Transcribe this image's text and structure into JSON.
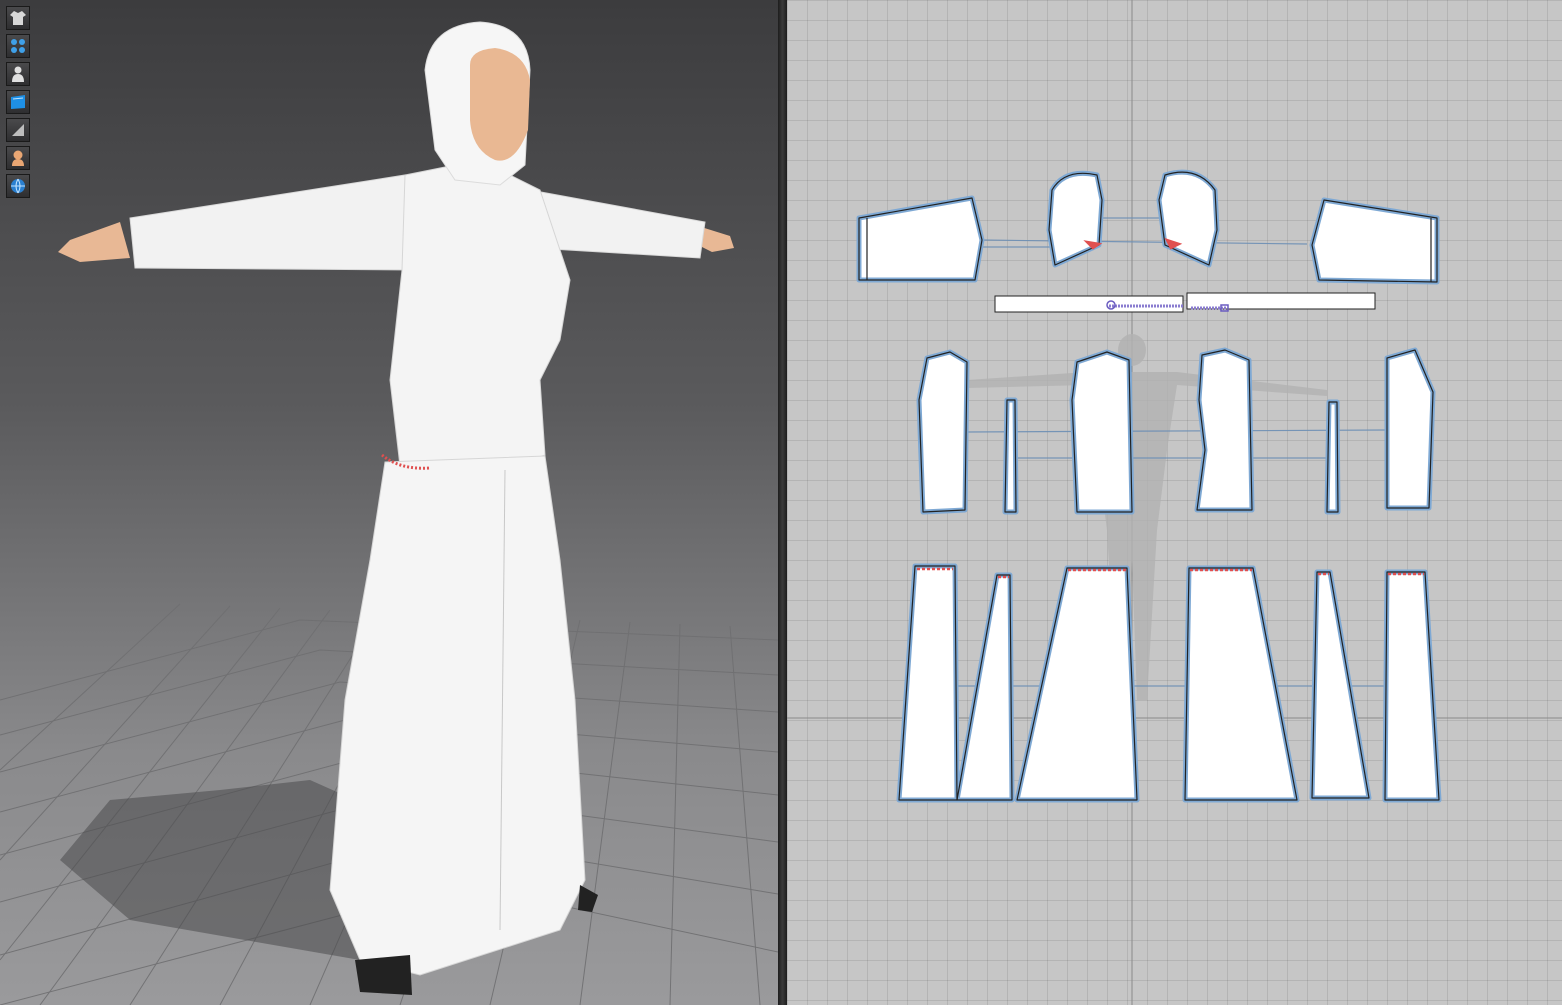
{
  "app": {
    "panels": [
      "3d-garment-window",
      "2d-pattern-window"
    ]
  },
  "toolbar": {
    "tools": [
      {
        "icon": "garment-shirt-icon"
      },
      {
        "icon": "arrangement-points-icon"
      },
      {
        "icon": "avatar-icon"
      },
      {
        "icon": "fabric-texture-icon"
      },
      {
        "icon": "flat-shading-icon"
      },
      {
        "icon": "avatar-skin-icon"
      },
      {
        "icon": "global-view-icon"
      }
    ]
  },
  "colors": {
    "viewport_3d_top": "#3c3c3e",
    "viewport_3d_bottom": "#9a9a9c",
    "viewport_2d_bg": "#c6c6c6",
    "pattern_fill": "#ffffff",
    "pattern_outline": "#7fa9d4",
    "seam_line": "#6d8fb5",
    "elastic_red": "#e05050",
    "garment": "#f4f4f4",
    "skin": "#e8b895"
  },
  "patterns": {
    "groups": [
      {
        "name": "sleeves",
        "count": 2
      },
      {
        "name": "hood",
        "count": 2
      },
      {
        "name": "zipper-bands",
        "count": 2
      },
      {
        "name": "bodice",
        "count": 6
      },
      {
        "name": "skirt",
        "count": 6
      }
    ]
  }
}
